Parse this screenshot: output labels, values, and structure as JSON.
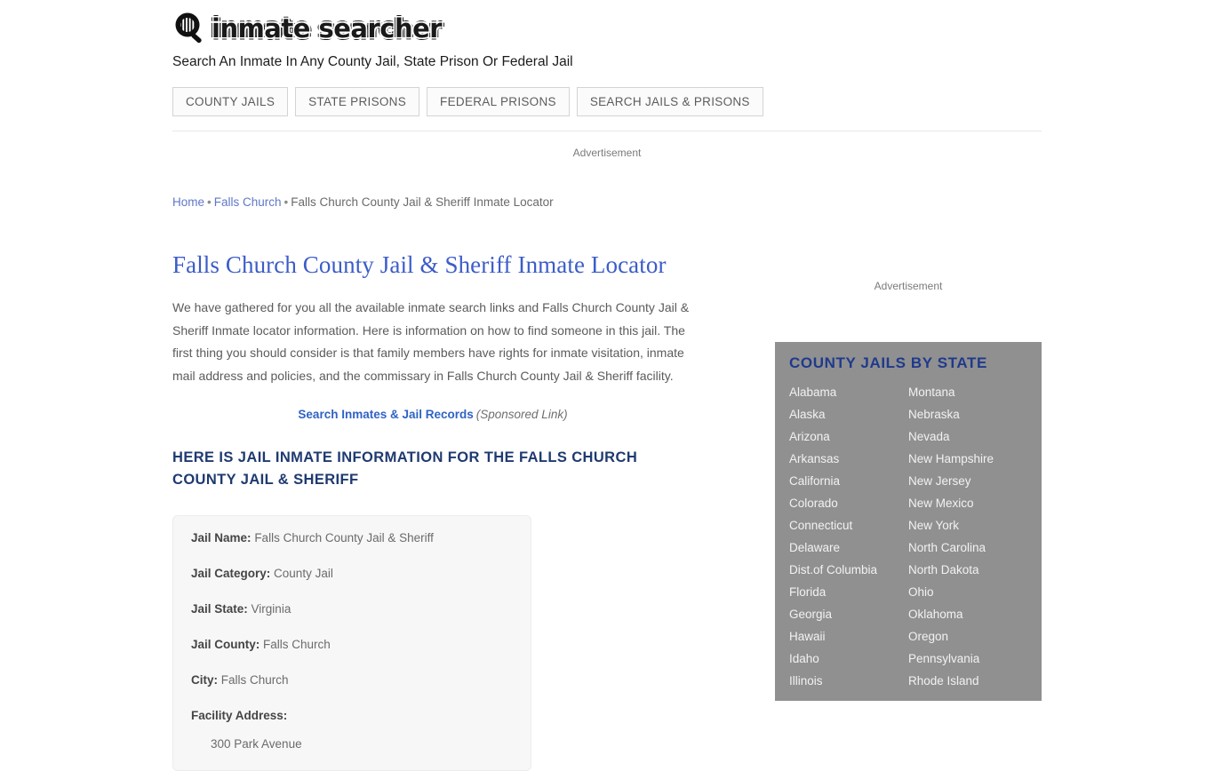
{
  "site": {
    "logo_icon": "magnifier-jail-icon",
    "wordmark": "inmate searcher",
    "tagline": "Search An Inmate In Any County Jail, State Prison Or Federal Jail",
    "accent_link": "#5f78c8",
    "title_color": "#3c5cc8",
    "heading_color": "#1f3a70",
    "panel_bg": "#909090"
  },
  "nav": {
    "items": [
      {
        "label": "COUNTY JAILS"
      },
      {
        "label": "STATE PRISONS"
      },
      {
        "label": "FEDERAL PRISONS"
      },
      {
        "label": "SEARCH JAILS & PRISONS"
      }
    ]
  },
  "ads": {
    "top_label": "Advertisement",
    "side_label": "Advertisement"
  },
  "breadcrumb": {
    "home": "Home",
    "sep1": "•",
    "city": "Falls Church",
    "sep2": "•",
    "current": "Falls Church County Jail & Sheriff Inmate Locator"
  },
  "main": {
    "title": "Falls Church County Jail & Sheriff Inmate Locator",
    "intro": "We have gathered for you all the available inmate search links and Falls Church County Jail & Sheriff Inmate locator information. Here is information on how to find someone in this jail. The first thing you should consider is that family members have rights for inmate visitation, inmate mail address and policies, and the commissary in Falls Church County Jail & Sheriff facility.",
    "sponsored_link": "Search Inmates & Jail Records",
    "sponsored_note": "(Sponsored Link)",
    "section_title": "HERE IS JAIL INMATE INFORMATION FOR THE FALLS CHURCH COUNTY JAIL & SHERIFF"
  },
  "jail_info": {
    "rows": [
      {
        "key": "Jail Name:",
        "value": "Falls Church County Jail & Sheriff"
      },
      {
        "key": "Jail Category:",
        "value": "County Jail"
      },
      {
        "key": "Jail State:",
        "value": "Virginia"
      },
      {
        "key": "Jail County:",
        "value": "Falls Church"
      },
      {
        "key": "City:",
        "value": "Falls Church"
      },
      {
        "key": "Facility Address:",
        "value": ""
      }
    ],
    "address_line1": "300 Park Avenue"
  },
  "states_panel": {
    "title": "COUNTY JAILS BY STATE",
    "col1": [
      "Alabama",
      "Alaska",
      "Arizona",
      "Arkansas",
      "California",
      "Colorado",
      "Connecticut",
      "Delaware",
      "Dist.of Columbia",
      "Florida",
      "Georgia",
      "Hawaii",
      "Idaho",
      "Illinois"
    ],
    "col2": [
      "Montana",
      "Nebraska",
      "Nevada",
      "New Hampshire",
      "New Jersey",
      "New Mexico",
      "New York",
      "North Carolina",
      "North Dakota",
      "Ohio",
      "Oklahoma",
      "Oregon",
      "Pennsylvania",
      "Rhode Island"
    ]
  }
}
